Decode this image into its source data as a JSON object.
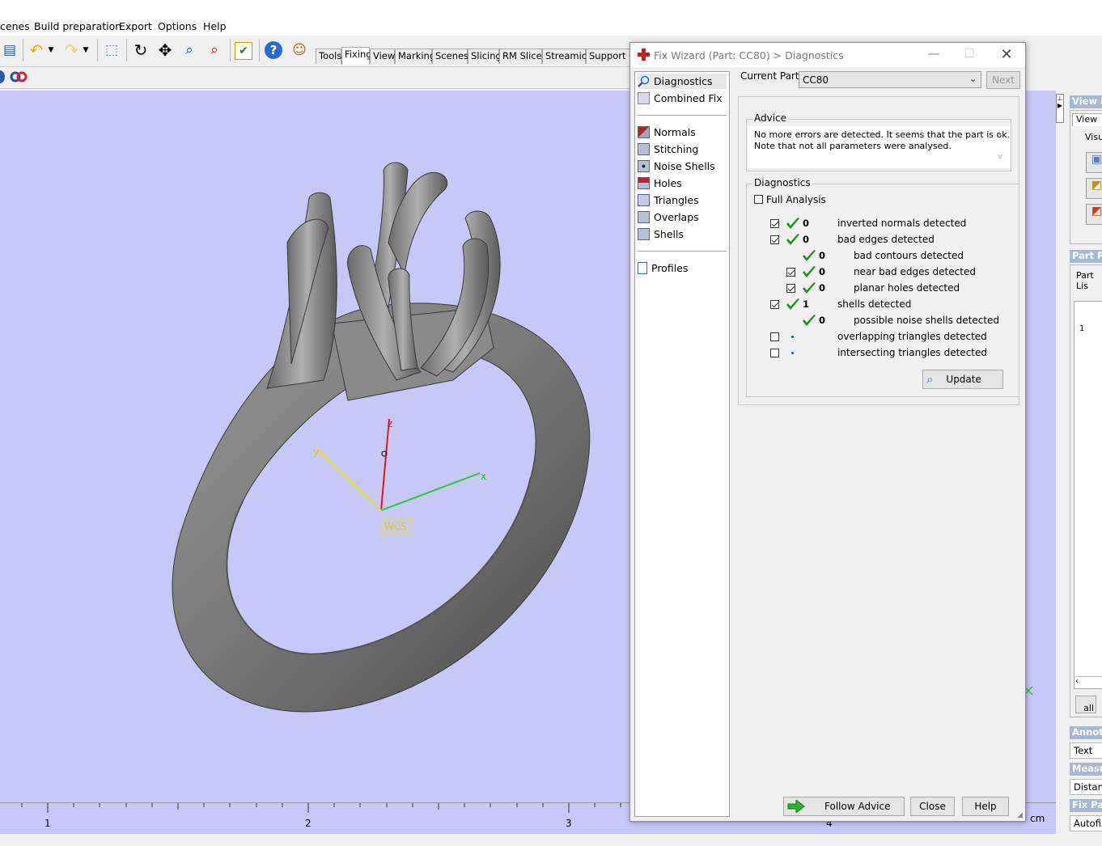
{
  "menu": [
    "cenes",
    "Build preparation",
    "Export",
    "Options",
    "Help"
  ],
  "tabs": [
    "Tools",
    "Fixing",
    "View",
    "Marking",
    "Scenes",
    "Slicing",
    "RM Slicer",
    "Streamics",
    "Support Ge"
  ],
  "active_tab": "Fixing",
  "viewport": {
    "background": "#c8c8f8",
    "axis_labels": {
      "z": "z",
      "x": "x",
      "y": "y",
      "wcs": "WCS"
    },
    "ruler_labels": [
      "1",
      "2",
      "3",
      "4"
    ],
    "ruler_unit": "cm"
  },
  "right_panel": {
    "view_header": "View P",
    "view_tab": "View",
    "visual_label": "Visua",
    "part_header": "Part Pa",
    "part_list": "Part Lis",
    "row_index": "1",
    "all_label": "all",
    "annot_header": "Annota",
    "text_button": "Text",
    "measure_header": "Measu",
    "distance_button": "Distanc",
    "fixpage_header": "Fix Pag",
    "autofix_button": "Autofix"
  },
  "dialog": {
    "title": "Fix Wizard (Part: CC80) > Diagnostics",
    "nav": {
      "diagnostics": "Diagnostics",
      "combined_fix": "Combined Fix",
      "normals": "Normals",
      "stitching": "Stitching",
      "noise_shells": "Noise Shells",
      "holes": "Holes",
      "triangles": "Triangles",
      "overlaps": "Overlaps",
      "shells": "Shells",
      "profiles": "Profiles"
    },
    "current_part_label": "Current Part:",
    "current_part_value": "CC80",
    "next_button": "Next",
    "advice_label": "Advice",
    "advice_line1": "No more errors are detected. It seems that the part is ok.",
    "advice_line2": "Note that not all parameters were analysed.",
    "diagnostics_label": "Diagnostics",
    "full_analysis": "Full Analysis",
    "rows": [
      {
        "count": "0",
        "label": "inverted normals detected",
        "checked": true
      },
      {
        "count": "0",
        "label": "bad edges detected",
        "checked": true
      },
      {
        "count": "0",
        "label": "bad contours detected",
        "checked": null
      },
      {
        "count": "0",
        "label": "near bad edges detected",
        "checked": true
      },
      {
        "count": "0",
        "label": "planar holes detected",
        "checked": true
      },
      {
        "count": "1",
        "label": "shells detected",
        "checked": true
      },
      {
        "count": "0",
        "label": "possible noise shells detected",
        "checked": null
      },
      {
        "count": "",
        "label": "overlapping triangles detected",
        "checked": false
      },
      {
        "count": "",
        "label": "intersecting triangles detected",
        "checked": false
      }
    ],
    "update_button": "Update",
    "follow_advice_button": "Follow Advice",
    "close_button": "Close",
    "help_button": "Help",
    "colors": {
      "check": "#2a8a2a",
      "accent": "#2050a0"
    }
  }
}
